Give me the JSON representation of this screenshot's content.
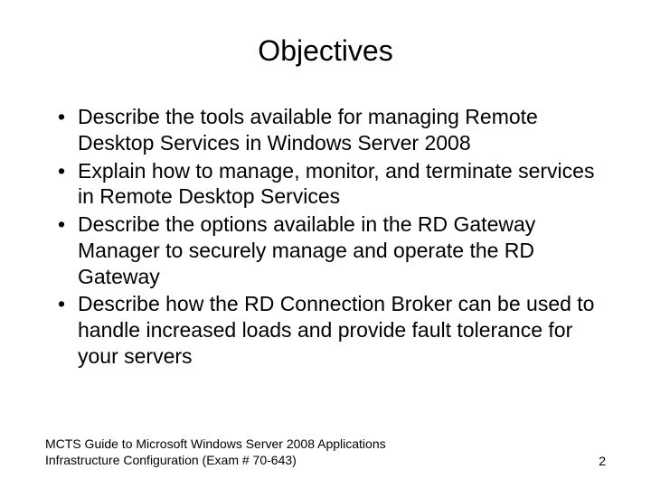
{
  "title": "Objectives",
  "bullets": {
    "item0": "Describe the tools available for managing Remote Desktop Services in Windows Server 2008",
    "item1": "Explain how to manage, monitor, and terminate services in Remote Desktop Services",
    "item2": "Describe the options available in the RD Gateway Manager to securely manage and operate the RD Gateway",
    "item3": "Describe how the RD Connection Broker can be used to handle increased loads and provide fault tolerance for your servers"
  },
  "footer": {
    "text": "MCTS Guide to Microsoft Windows Server 2008 Applications Infrastructure Configuration (Exam # 70-643)",
    "page": "2"
  }
}
